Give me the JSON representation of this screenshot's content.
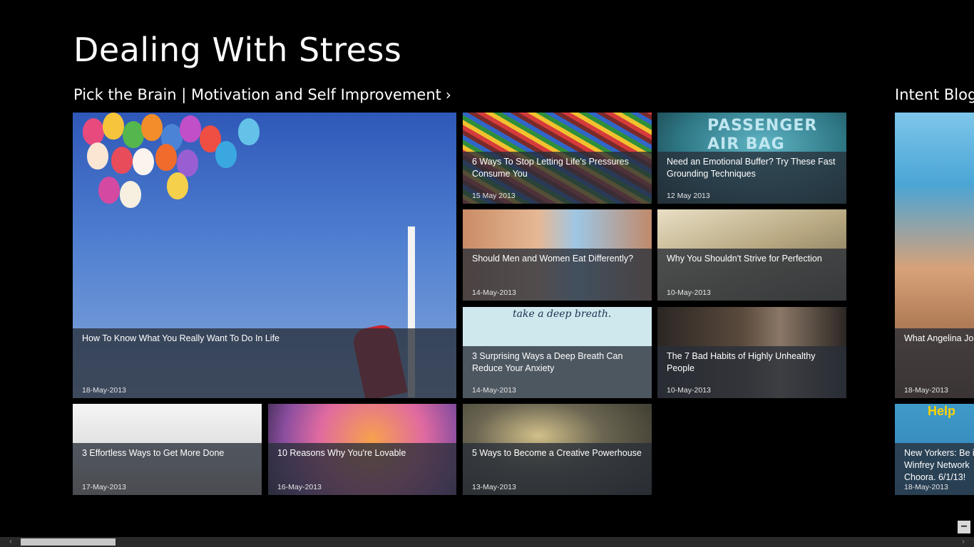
{
  "page": {
    "title": "Dealing With Stress"
  },
  "groups": [
    {
      "header": "Pick the Brain | Motivation and Self Improvement",
      "chevron": "›"
    },
    {
      "header": "Intent Blog"
    }
  ],
  "tiles": [
    {
      "title": "How To Know What You Really Want To Do In Life",
      "date": "18-May-2013"
    },
    {
      "title": "6 Ways To Stop Letting Life's Pressures Consume You",
      "date": "15 May 2013"
    },
    {
      "title": "Need an Emotional Buffer? Try These Fast Grounding Techniques",
      "date": "12 May 2013"
    },
    {
      "title": "Should Men and Women Eat Differently?",
      "date": "14-May-2013"
    },
    {
      "title": "Why You Shouldn't Strive for Perfection",
      "date": "10-May-2013"
    },
    {
      "title": "3 Surprising Ways a Deep Breath Can Reduce Your Anxiety",
      "date": "14-May-2013"
    },
    {
      "title": "The 7 Bad Habits of Highly Unhealthy People",
      "date": "10-May-2013"
    },
    {
      "title": "3 Effortless Ways to Get More Done",
      "date": "17-May-2013"
    },
    {
      "title": "10 Reasons Why You're Lovable",
      "date": "16-May-2013"
    },
    {
      "title": "5 Ways to Become a Creative Powerhouse",
      "date": "13-May-2013"
    },
    {
      "title": "What Angelina Jo",
      "date": "18-May-2013"
    },
    {
      "title": "New Yorkers: Be i Winfrey Network Choora. 6/1/13!",
      "date": "18-May-2013"
    }
  ],
  "art_text": {
    "airbag": "PASSENGER\nAIR BAG",
    "breath": "take a deep breath.",
    "help": "Help"
  },
  "scrollbar": {
    "left_arrow": "‹",
    "right_arrow": "›"
  },
  "zoom_button": {
    "label": "–"
  },
  "colors": {
    "background": "#000000",
    "overlay": "#282e38",
    "scrollbar": "#2b2b2b"
  }
}
